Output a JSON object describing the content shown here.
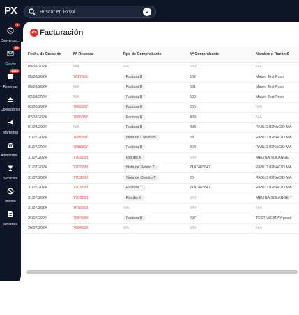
{
  "app": {
    "logo": "PX"
  },
  "search": {
    "placeholder": "Buscar en Pxsol"
  },
  "sidebar": {
    "items": [
      {
        "label": "Conversac...",
        "icon": "whatsapp-icon",
        "badge": "4"
      },
      {
        "label": "Correo",
        "icon": "mail-icon",
        "badge": "55"
      },
      {
        "label": "Reservas",
        "icon": "calendar-icon",
        "badge": "1439"
      },
      {
        "label": "Operaciones",
        "icon": "eject-icon",
        "badge": ""
      },
      {
        "label": "Marketing",
        "icon": "megaphone-icon",
        "badge": ""
      },
      {
        "label": "Administra...",
        "icon": "bank-icon",
        "badge": ""
      },
      {
        "label": "Servicios",
        "icon": "cocktail-icon",
        "badge": ""
      },
      {
        "label": "Interno",
        "icon": "ban-icon",
        "badge": ""
      },
      {
        "label": "Informes",
        "icon": "report-icon",
        "badge": ""
      }
    ]
  },
  "page": {
    "title": "Facturación",
    "title_icon_text": "PX"
  },
  "table": {
    "columns": [
      "Fecha de Creación",
      "Nº Reserva",
      "Tipo de Comprobante",
      "Nº Comprobante",
      "Nombre o Razón S"
    ],
    "rows": [
      {
        "fecha": "05/08/2024",
        "reserva": "N/A",
        "tipo": "N/A",
        "numero": "S/N",
        "nombre": "N/A"
      },
      {
        "fecha": "05/08/2024",
        "reserva": "7017656",
        "tipo": "Factura B",
        "numero": "502",
        "nombre": "Mauro Test Pxsol"
      },
      {
        "fecha": "05/08/2024",
        "reserva": "N/A",
        "tipo": "Factura B",
        "numero": "501",
        "nombre": "Mauro Test Pxsol"
      },
      {
        "fecha": "02/08/2024",
        "reserva": "N/A",
        "tipo": "Factura B",
        "numero": "500",
        "nombre": "Mauro Test Pxsol"
      },
      {
        "fecha": "02/08/2024",
        "reserva": "7686337",
        "tipo": "Factura B",
        "numero": "205",
        "nombre": "N/A"
      },
      {
        "fecha": "02/08/2024",
        "reserva": "7686337",
        "tipo": "Factura B",
        "numero": "499",
        "nombre": "N/A"
      },
      {
        "fecha": "01/08/2024",
        "reserva": "N/A",
        "tipo": "Factura B",
        "numero": "498",
        "nombre": "PABLO IGNACIO MA"
      },
      {
        "fecha": "31/07/2024",
        "reserva": "7686337",
        "tipo": "Nota de Credito B",
        "numero": "33",
        "nombre": "PABLO IGNACIO MA"
      },
      {
        "fecha": "31/07/2024",
        "reserva": "7686337",
        "tipo": "Factura B",
        "numero": "204",
        "nombre": "PABLO IGNACIO MA"
      },
      {
        "fecha": "31/07/2024",
        "reserva": "7703290",
        "tipo": "Recibo X",
        "numero": "S/N",
        "nombre": "MELINA SOLANGE T"
      },
      {
        "fecha": "31/07/2024",
        "reserva": "7703290",
        "tipo": "Nota de Debito T",
        "numero": "2147483647",
        "nombre": "PABLO IGNACIO MA"
      },
      {
        "fecha": "31/07/2024",
        "reserva": "7703290",
        "tipo": "Nota de Credito T",
        "numero": "26",
        "nombre": "PABLO IGNACIO MA"
      },
      {
        "fecha": "31/07/2024",
        "reserva": "7703290",
        "tipo": "Factura T",
        "numero": "2147483647",
        "nombre": "PABLO IGNACIO MA"
      },
      {
        "fecha": "31/07/2024",
        "reserva": "7703290",
        "tipo": "Recibo X",
        "numero": "S/N",
        "nombre": "MELINA SOLANGE T"
      },
      {
        "fecha": "31/07/2024",
        "reserva": "7676558",
        "tipo": "N/A",
        "numero": "S/N",
        "nombre": "N/A"
      },
      {
        "fecha": "26/07/2024",
        "reserva": "7684538",
        "tipo": "Factura B",
        "numero": "497",
        "nombre": "TEST WEBPAY pxsol"
      },
      {
        "fecha": "26/07/2024",
        "reserva": "7684538",
        "tipo": "N/A",
        "numero": "S/N",
        "nombre": "N/A"
      }
    ]
  },
  "colors": {
    "shell": "#0e1628",
    "accent": "#e53935",
    "muted": "#9ea3ad"
  }
}
